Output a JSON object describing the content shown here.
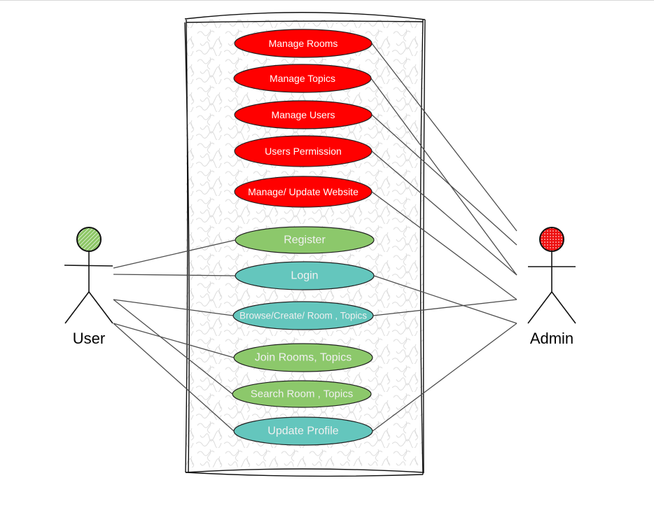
{
  "diagram": {
    "type": "use-case",
    "system_boundary": {
      "fill": "hatched-light-gray"
    },
    "actors": [
      {
        "id": "user",
        "label": "User",
        "head_color": "#8cc665",
        "head_fill_style": "hatch"
      },
      {
        "id": "admin",
        "label": "Admin",
        "head_color": "#ee1111",
        "head_fill_style": "cross-hatch"
      }
    ],
    "use_cases": [
      {
        "id": "manage-rooms",
        "label": "Manage Rooms",
        "fill": "#ff0000",
        "text_color": "#ffffff"
      },
      {
        "id": "manage-topics",
        "label": "Manage Topics",
        "fill": "#ff0000",
        "text_color": "#ffffff"
      },
      {
        "id": "manage-users",
        "label": "Manage Users",
        "fill": "#ff0000",
        "text_color": "#ffffff"
      },
      {
        "id": "users-permission",
        "label": "Users Permission",
        "fill": "#ff0000",
        "text_color": "#ffffff"
      },
      {
        "id": "manage-update-website",
        "label": "Manage/ Update Website",
        "fill": "#ff0000",
        "text_color": "#ffffff"
      },
      {
        "id": "register",
        "label": "Register",
        "fill": "#8cc86b",
        "text_color": "#f0f0f0"
      },
      {
        "id": "login",
        "label": "Login",
        "fill": "#64c6bd",
        "text_color": "#f0f0f0"
      },
      {
        "id": "browse-create",
        "label": "Browse/Create/ Room , Topics",
        "fill": "#64c6bd",
        "text_color": "#f0f0f0"
      },
      {
        "id": "join-rooms",
        "label": "Join Rooms, Topics",
        "fill": "#8cc86b",
        "text_color": "#f0f0f0"
      },
      {
        "id": "search-room",
        "label": "Search Room , Topics",
        "fill": "#8cc86b",
        "text_color": "#f0f0f0"
      },
      {
        "id": "update-profile",
        "label": "Update Profile",
        "fill": "#64c6bd",
        "text_color": "#f0f0f0"
      }
    ],
    "associations": [
      {
        "actor": "user",
        "use_case": "register"
      },
      {
        "actor": "user",
        "use_case": "login"
      },
      {
        "actor": "user",
        "use_case": "browse-create"
      },
      {
        "actor": "user",
        "use_case": "search-room"
      },
      {
        "actor": "user",
        "use_case": "join-rooms"
      },
      {
        "actor": "user",
        "use_case": "update-profile"
      },
      {
        "actor": "admin",
        "use_case": "manage-rooms"
      },
      {
        "actor": "admin",
        "use_case": "manage-topics"
      },
      {
        "actor": "admin",
        "use_case": "manage-users"
      },
      {
        "actor": "admin",
        "use_case": "users-permission"
      },
      {
        "actor": "admin",
        "use_case": "manage-update-website"
      },
      {
        "actor": "admin",
        "use_case": "login"
      },
      {
        "actor": "admin",
        "use_case": "browse-create"
      },
      {
        "actor": "admin",
        "use_case": "update-profile"
      }
    ]
  }
}
